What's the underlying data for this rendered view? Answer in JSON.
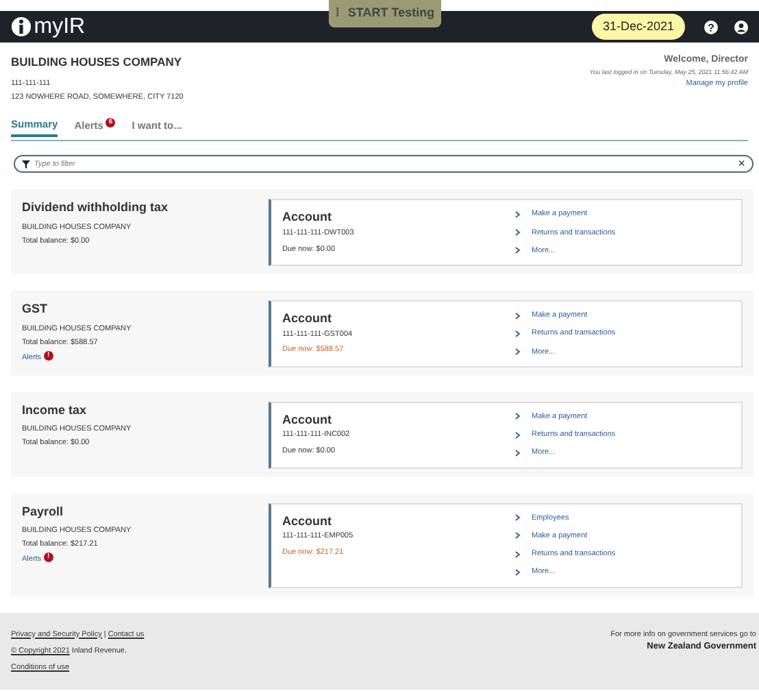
{
  "navbar": {
    "logo": "myIR",
    "test_handle": "⁞",
    "test_label": "START Testing",
    "date": "31-Dec-2021",
    "help": "?"
  },
  "header": {
    "company": "BUILDING HOUSES COMPANY",
    "ird": "111-111-111",
    "address": "123 NOWHERE ROAD, SOMEWHERE, CITY 7120",
    "welcome": "Welcome, Director",
    "last_login": "You last logged in on Tuesday, May 25, 2021 11:56:42 AM",
    "profile_link": "Manage my profile"
  },
  "tabs": [
    {
      "label": "Summary",
      "selected": true
    },
    {
      "label": "Alerts",
      "selected": false,
      "badge": "6"
    },
    {
      "label": "I want to...",
      "selected": false
    }
  ],
  "filter": {
    "placeholder": "Type to filter",
    "clear": "×"
  },
  "accounts": [
    {
      "title": "Dividend withholding tax",
      "company": "BUILDING HOUSES COMPANY",
      "balance": "Total balance: $0.00",
      "account_label": "Account",
      "number": "111-111-111-DWT003",
      "due": "Due now: $0.00",
      "overdue": false,
      "links": [
        "Make a payment",
        "Returns and transactions",
        "More..."
      ]
    },
    {
      "title": "GST",
      "company": "BUILDING HOUSES COMPANY",
      "balance": "Total balance: $588.57",
      "alerts": "Alerts",
      "alerts_badge": "!",
      "account_label": "Account",
      "number": "111-111-111-GST004",
      "due": "Due now: $588.57",
      "overdue": true,
      "links": [
        "Make a payment",
        "Returns and transactions",
        "More..."
      ]
    },
    {
      "title": "Income tax",
      "company": "BUILDING HOUSES COMPANY",
      "balance": "Total balance: $0.00",
      "account_label": "Account",
      "number": "111-111-111-INC002",
      "due": "Due now: $0.00",
      "overdue": false,
      "links": [
        "Make a payment",
        "Returns and transactions",
        "More..."
      ]
    },
    {
      "title": "Payroll",
      "company": "BUILDING HOUSES COMPANY",
      "balance": "Total balance: $217.21",
      "alerts": "Alerts",
      "alerts_badge": "!",
      "account_label": "Account",
      "number": "111-111-111-EMP005",
      "due": "Due now: $217.21",
      "overdue": true,
      "links": [
        "Employees",
        "Make a payment",
        "Returns and transactions",
        "More..."
      ]
    }
  ],
  "footer": {
    "privacy": "Privacy and Security Policy",
    "separator": "|",
    "contact": "Contact us",
    "copyright": "© Copyright 2021",
    "owner": "Inland Revenue.",
    "conditions": "Conditions of use",
    "gov_info": "For more info on government services go to",
    "gov_link": "New Zealand Government"
  }
}
